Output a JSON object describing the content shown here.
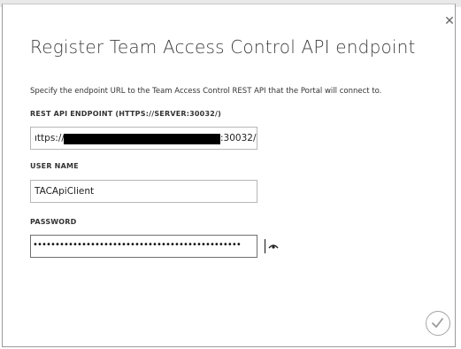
{
  "dialog": {
    "title": "Register Team Access Control API endpoint",
    "description": "Specify the endpoint URL to the Team Access Control REST API that the Portal will connect to.",
    "close_icon": "close-icon",
    "confirm_icon": "checkmark-icon"
  },
  "fields": {
    "endpoint": {
      "label": "REST API ENDPOINT (HTTPS://SERVER:30032/)",
      "value_prefix": "ıttps://",
      "value_suffix": ":30032/"
    },
    "username": {
      "label": "USER NAME",
      "value": "TACApiClient"
    },
    "password": {
      "label": "PASSWORD",
      "value": "•••••••••••••••••••••••••••••••••••••••••••••••",
      "reveal_icon": "eye-icon"
    }
  }
}
